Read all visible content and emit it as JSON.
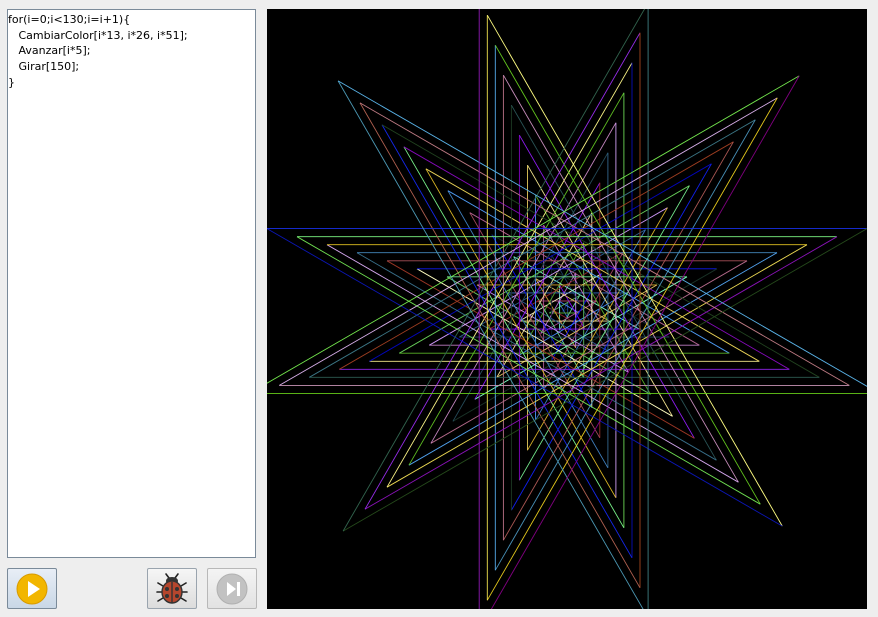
{
  "editor": {
    "code_lines": [
      "for(i=0;i<130;i=i+1){",
      "   CambiarColor[i*13, i*26, i*51];",
      "   Avanzar[i*5];",
      "   Girar[150];",
      "}"
    ]
  },
  "toolbar": {
    "run_icon": "play-icon",
    "debug_icon": "ladybug-icon",
    "step_icon": "step-forward-icon"
  },
  "turtle": {
    "iterations": 130,
    "color_multipliers": [
      13,
      26,
      51
    ],
    "step_multiplier": 5,
    "turn_degrees": 150,
    "background": "#000000"
  },
  "colors": {
    "run_accent": "#f2b600",
    "bug_body": "#b5462d",
    "disabled_icon": "#c2c2c2"
  }
}
